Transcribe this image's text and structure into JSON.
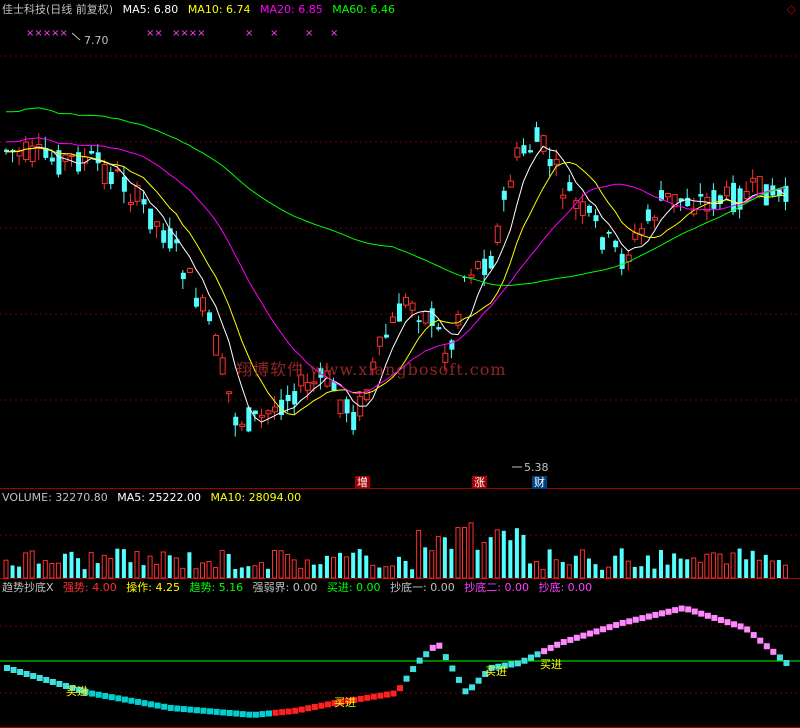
{
  "price_panel": {
    "title": "佳士科技(日线 前复权)",
    "ma5": "MA5: 6.80",
    "ma10": "MA10: 6.74",
    "ma20": "MA20: 6.85",
    "ma60": "MA60: 6.46",
    "high_label": "7.70",
    "low_label": "5.38",
    "tags": [
      "增",
      "涨",
      "财"
    ],
    "marker_rows": [
      "×××××",
      "××",
      "××××",
      "×",
      "×",
      "×",
      "×"
    ]
  },
  "volume_panel": {
    "volume": "VOLUME: 32270.80",
    "ma5": "MA5: 25222.00",
    "ma10": "MA10: 28094.00"
  },
  "indicator_panel": {
    "name": "趋势抄底X",
    "strong": "强势: 4.00",
    "operate": "操作: 4.25",
    "trend": "趋势: 5.16",
    "boundary": "强弱界: 0.00",
    "buy": "买进: 0.00",
    "bottom1": "抄底一: 0.00",
    "bottom2": "抄底二: 0.00",
    "bottom": "抄底: 0.00",
    "signal_buy": "买进"
  },
  "watermark": "翔博软件 www.xiangbosoft.com",
  "colors": {
    "up": "#ff3030",
    "down": "#54ffff",
    "ma5": "#ffffff",
    "ma10": "#ffff00",
    "ma20": "#ff00ff",
    "ma60": "#00ff00",
    "grid": "#7a0000"
  }
}
